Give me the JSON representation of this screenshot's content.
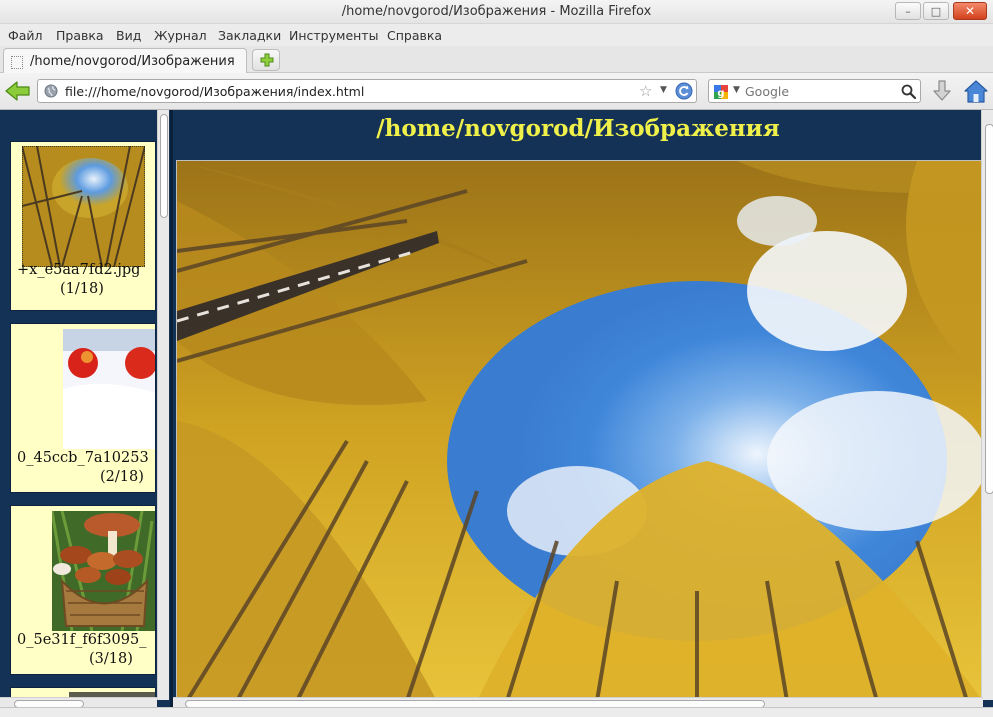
{
  "window": {
    "title": "/home/novgorod/Изображения - Mozilla Firefox",
    "minimize_glyph": "–",
    "maximize_glyph": "□",
    "close_glyph": "✕"
  },
  "menu": {
    "items": [
      "Файл",
      "Правка",
      "Вид",
      "Журнал",
      "Закладки",
      "Инструменты",
      "Справка"
    ]
  },
  "tabs": [
    {
      "label": "/home/novgorod/Изображения"
    }
  ],
  "navbar": {
    "url": "file:///home/novgorod/Изображения/index.html",
    "search_placeholder": "Google",
    "icons": [
      "back-arrow-icon",
      "globe-icon",
      "bookmark-star-icon",
      "reload-icon",
      "google-icon",
      "magnifier-icon",
      "download-arrow-icon",
      "home-icon"
    ]
  },
  "gallery": {
    "heading": "/home/novgorod/Изображения",
    "thumbnails": [
      {
        "filename": "+x_e5aa7fd2.jpg",
        "position": "(1/18)",
        "subject": "birch-forest-photo"
      },
      {
        "filename": "0_45ccb_7a10253",
        "position": "(2/18)",
        "subject": "apples-in-snow-photo"
      },
      {
        "filename": "0_5e31f_f6f3095_",
        "position": "(3/18)",
        "subject": "mushroom-basket-photo"
      }
    ],
    "main_image_subject": "birch-forest-photo"
  },
  "colors": {
    "frame_background": "#133256",
    "thumbnail_background": "#ffffc6",
    "heading_color": "#f0f04a"
  }
}
